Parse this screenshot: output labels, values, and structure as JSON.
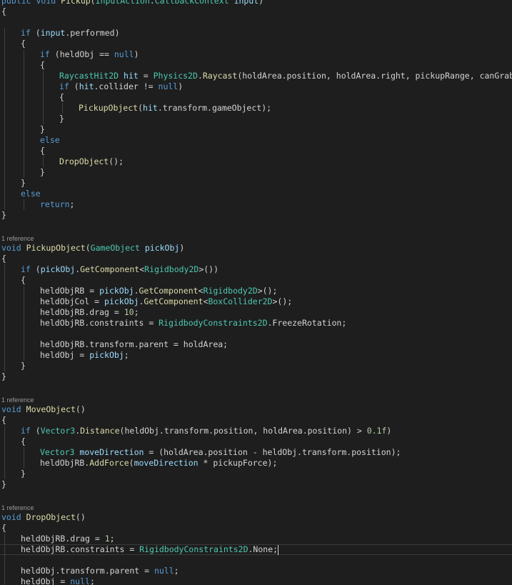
{
  "editor": {
    "colors": {
      "background": "#1e1e1e",
      "keyword": "#569cd6",
      "type": "#4ec9b0",
      "method": "#dcdcaa",
      "parameter": "#9cdcfe",
      "number": "#b5cea8",
      "text": "#d4d4d4",
      "codelens": "#999999"
    },
    "lines": [
      {
        "kind": "code",
        "indent": 0,
        "tokens": [
          [
            "public",
            "kw"
          ],
          [
            " ",
            ""
          ],
          [
            "void",
            "kw"
          ],
          [
            " ",
            ""
          ],
          [
            "Pickup",
            "fn"
          ],
          [
            "(",
            ""
          ],
          [
            "InputAction",
            "ty"
          ],
          [
            ".",
            ""
          ],
          [
            "CallbackContext",
            "ty"
          ],
          [
            " ",
            ""
          ],
          [
            "input",
            "pa"
          ],
          [
            ")",
            ""
          ]
        ]
      },
      {
        "kind": "code",
        "indent": 0,
        "tokens": [
          [
            "{",
            ""
          ]
        ]
      },
      {
        "kind": "code",
        "indent": 0,
        "tokens": []
      },
      {
        "kind": "code",
        "indent": 1,
        "tokens": [
          [
            "if",
            "kw"
          ],
          [
            " (",
            ""
          ],
          [
            "input",
            "pa"
          ],
          [
            ".performed)",
            ""
          ]
        ]
      },
      {
        "kind": "code",
        "indent": 1,
        "tokens": [
          [
            "{",
            ""
          ]
        ]
      },
      {
        "kind": "code",
        "indent": 2,
        "tokens": [
          [
            "if",
            "kw"
          ],
          [
            " (heldObj == ",
            ""
          ],
          [
            "null",
            "kw"
          ],
          [
            ")",
            ""
          ]
        ]
      },
      {
        "kind": "code",
        "indent": 2,
        "tokens": [
          [
            "{",
            ""
          ]
        ]
      },
      {
        "kind": "code",
        "indent": 3,
        "tokens": [
          [
            "RaycastHit2D",
            "ty"
          ],
          [
            " ",
            ""
          ],
          [
            "hit",
            "pa"
          ],
          [
            " = ",
            ""
          ],
          [
            "Physics2D",
            "ty"
          ],
          [
            ".",
            ""
          ],
          [
            "Raycast",
            "fn"
          ],
          [
            "(holdArea.position, holdArea.right, pickupRange, canGrab);",
            ""
          ]
        ]
      },
      {
        "kind": "code",
        "indent": 3,
        "tokens": [
          [
            "if",
            "kw"
          ],
          [
            " (",
            ""
          ],
          [
            "hit",
            "pa"
          ],
          [
            ".collider != ",
            ""
          ],
          [
            "null",
            "kw"
          ],
          [
            ")",
            ""
          ]
        ]
      },
      {
        "kind": "code",
        "indent": 3,
        "tokens": [
          [
            "{",
            ""
          ]
        ]
      },
      {
        "kind": "code",
        "indent": 4,
        "tokens": [
          [
            "PickupObject",
            "fn"
          ],
          [
            "(",
            ""
          ],
          [
            "hit",
            "pa"
          ],
          [
            ".transform.gameObject);",
            ""
          ]
        ]
      },
      {
        "kind": "code",
        "indent": 3,
        "tokens": [
          [
            "}",
            ""
          ]
        ]
      },
      {
        "kind": "code",
        "indent": 2,
        "tokens": [
          [
            "}",
            ""
          ]
        ]
      },
      {
        "kind": "code",
        "indent": 2,
        "tokens": [
          [
            "else",
            "kw"
          ]
        ]
      },
      {
        "kind": "code",
        "indent": 2,
        "tokens": [
          [
            "{",
            ""
          ]
        ]
      },
      {
        "kind": "code",
        "indent": 3,
        "tokens": [
          [
            "DropObject",
            "fn"
          ],
          [
            "();",
            ""
          ]
        ]
      },
      {
        "kind": "code",
        "indent": 2,
        "tokens": [
          [
            "}",
            ""
          ]
        ]
      },
      {
        "kind": "code",
        "indent": 1,
        "tokens": [
          [
            "}",
            ""
          ]
        ]
      },
      {
        "kind": "code",
        "indent": 1,
        "tokens": [
          [
            "else",
            "kw"
          ]
        ]
      },
      {
        "kind": "code",
        "indent": 2,
        "tokens": [
          [
            "return",
            "kw"
          ],
          [
            ";",
            ""
          ]
        ]
      },
      {
        "kind": "code",
        "indent": 0,
        "tokens": [
          [
            "}",
            ""
          ]
        ]
      },
      {
        "kind": "code",
        "indent": 0,
        "tokens": []
      },
      {
        "kind": "codelens",
        "indent": 0,
        "text": "1 reference"
      },
      {
        "kind": "code",
        "indent": 0,
        "tokens": [
          [
            "void",
            "kw"
          ],
          [
            " ",
            ""
          ],
          [
            "PickupObject",
            "fn"
          ],
          [
            "(",
            ""
          ],
          [
            "GameObject",
            "ty"
          ],
          [
            " ",
            ""
          ],
          [
            "pickObj",
            "pa"
          ],
          [
            ")",
            ""
          ]
        ]
      },
      {
        "kind": "code",
        "indent": 0,
        "tokens": [
          [
            "{",
            ""
          ]
        ]
      },
      {
        "kind": "code",
        "indent": 1,
        "tokens": [
          [
            "if",
            "kw"
          ],
          [
            " (",
            ""
          ],
          [
            "pickObj",
            "pa"
          ],
          [
            ".",
            ""
          ],
          [
            "GetComponent",
            "fn"
          ],
          [
            "<",
            ""
          ],
          [
            "Rigidbody2D",
            "ty"
          ],
          [
            ">())",
            ""
          ]
        ]
      },
      {
        "kind": "code",
        "indent": 1,
        "tokens": [
          [
            "{",
            ""
          ]
        ]
      },
      {
        "kind": "code",
        "indent": 2,
        "tokens": [
          [
            "heldObjRB = ",
            ""
          ],
          [
            "pickObj",
            "pa"
          ],
          [
            ".",
            ""
          ],
          [
            "GetComponent",
            "fn"
          ],
          [
            "<",
            ""
          ],
          [
            "Rigidbody2D",
            "ty"
          ],
          [
            ">();",
            ""
          ]
        ]
      },
      {
        "kind": "code",
        "indent": 2,
        "tokens": [
          [
            "heldObjCol = ",
            ""
          ],
          [
            "pickObj",
            "pa"
          ],
          [
            ".",
            ""
          ],
          [
            "GetComponent",
            "fn"
          ],
          [
            "<",
            ""
          ],
          [
            "BoxCollider2D",
            "ty"
          ],
          [
            ">();",
            ""
          ]
        ]
      },
      {
        "kind": "code",
        "indent": 2,
        "tokens": [
          [
            "heldObjRB.drag = ",
            ""
          ],
          [
            "10",
            "nu"
          ],
          [
            ";",
            ""
          ]
        ]
      },
      {
        "kind": "code",
        "indent": 2,
        "tokens": [
          [
            "heldObjRB.constraints = ",
            ""
          ],
          [
            "RigidbodyConstraints2D",
            "ty"
          ],
          [
            ".FreezeRotation;",
            ""
          ]
        ]
      },
      {
        "kind": "code",
        "indent": 2,
        "tokens": []
      },
      {
        "kind": "code",
        "indent": 2,
        "tokens": [
          [
            "heldObjRB.transform.parent = holdArea;",
            ""
          ]
        ]
      },
      {
        "kind": "code",
        "indent": 2,
        "tokens": [
          [
            "heldObj = ",
            ""
          ],
          [
            "pickObj",
            "pa"
          ],
          [
            ";",
            ""
          ]
        ]
      },
      {
        "kind": "code",
        "indent": 1,
        "tokens": [
          [
            "}",
            ""
          ]
        ]
      },
      {
        "kind": "code",
        "indent": 0,
        "tokens": [
          [
            "}",
            ""
          ]
        ]
      },
      {
        "kind": "code",
        "indent": 0,
        "tokens": []
      },
      {
        "kind": "codelens",
        "indent": 0,
        "text": "1 reference"
      },
      {
        "kind": "code",
        "indent": 0,
        "tokens": [
          [
            "void",
            "kw"
          ],
          [
            " ",
            ""
          ],
          [
            "MoveObject",
            "fn"
          ],
          [
            "()",
            ""
          ]
        ]
      },
      {
        "kind": "code",
        "indent": 0,
        "tokens": [
          [
            "{",
            ""
          ]
        ]
      },
      {
        "kind": "code",
        "indent": 1,
        "tokens": [
          [
            "if",
            "kw"
          ],
          [
            " (",
            ""
          ],
          [
            "Vector3",
            "ty"
          ],
          [
            ".",
            ""
          ],
          [
            "Distance",
            "fn"
          ],
          [
            "(heldObj.transform.position, holdArea.position) > ",
            ""
          ],
          [
            "0.1f",
            "nu"
          ],
          [
            ")",
            ""
          ]
        ]
      },
      {
        "kind": "code",
        "indent": 1,
        "tokens": [
          [
            "{",
            ""
          ]
        ]
      },
      {
        "kind": "code",
        "indent": 2,
        "tokens": [
          [
            "Vector3",
            "ty"
          ],
          [
            " ",
            ""
          ],
          [
            "moveDirection",
            "pa"
          ],
          [
            " = (holdArea.position - heldObj.transform.position);",
            ""
          ]
        ]
      },
      {
        "kind": "code",
        "indent": 2,
        "tokens": [
          [
            "heldObjRB.",
            ""
          ],
          [
            "AddForce",
            "fn"
          ],
          [
            "(",
            ""
          ],
          [
            "moveDirection",
            "pa"
          ],
          [
            " * pickupForce);",
            ""
          ]
        ]
      },
      {
        "kind": "code",
        "indent": 1,
        "tokens": [
          [
            "}",
            ""
          ]
        ]
      },
      {
        "kind": "code",
        "indent": 0,
        "tokens": [
          [
            "}",
            ""
          ]
        ]
      },
      {
        "kind": "code",
        "indent": 0,
        "tokens": []
      },
      {
        "kind": "codelens",
        "indent": 0,
        "text": "1 reference"
      },
      {
        "kind": "code",
        "indent": 0,
        "tokens": [
          [
            "void",
            "kw"
          ],
          [
            " ",
            ""
          ],
          [
            "DropObject",
            "fn"
          ],
          [
            "()",
            ""
          ]
        ]
      },
      {
        "kind": "code",
        "indent": 0,
        "tokens": [
          [
            "{",
            ""
          ]
        ]
      },
      {
        "kind": "code",
        "indent": 1,
        "tokens": [
          [
            "heldObjRB.drag = ",
            ""
          ],
          [
            "1",
            "nu"
          ],
          [
            ";",
            ""
          ]
        ]
      },
      {
        "kind": "code",
        "indent": 1,
        "current": true,
        "tokens": [
          [
            "heldObjRB.constraints = ",
            ""
          ],
          [
            "RigidbodyConstraints2D",
            "ty"
          ],
          [
            ".None;",
            ""
          ]
        ]
      },
      {
        "kind": "code",
        "indent": 1,
        "tokens": []
      },
      {
        "kind": "code",
        "indent": 1,
        "tokens": [
          [
            "heldObj.transform.parent = ",
            ""
          ],
          [
            "null",
            "kw"
          ],
          [
            ";",
            ""
          ]
        ]
      },
      {
        "kind": "code",
        "indent": 1,
        "tokens": [
          [
            "heldObj = ",
            ""
          ],
          [
            "null",
            "kw"
          ],
          [
            ";",
            ""
          ]
        ]
      },
      {
        "kind": "code",
        "indent": 0,
        "tokens": [
          [
            "}",
            ""
          ]
        ]
      }
    ]
  }
}
